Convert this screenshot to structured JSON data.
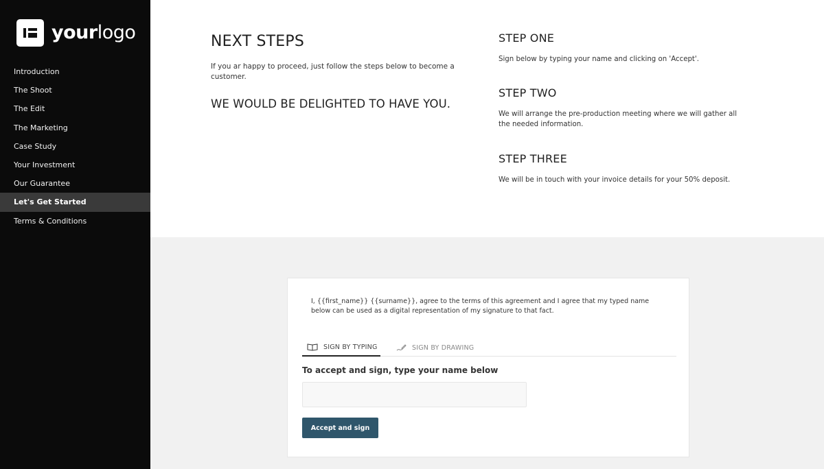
{
  "sidebar": {
    "logo": {
      "bold": "your",
      "light": "logo",
      "icon": "logo-mark-icon"
    },
    "items": [
      {
        "label": "Introduction",
        "active": false
      },
      {
        "label": "The Shoot",
        "active": false
      },
      {
        "label": "The Edit",
        "active": false
      },
      {
        "label": "The Marketing",
        "active": false
      },
      {
        "label": "Case Study",
        "active": false
      },
      {
        "label": "Your Investment",
        "active": false
      },
      {
        "label": "Our Guarantee",
        "active": false
      },
      {
        "label": "Let's Get Started",
        "active": true
      },
      {
        "label": "Terms & Conditions",
        "active": false
      }
    ]
  },
  "main": {
    "title": "NEXT STEPS",
    "intro": "If you ar happy to proceed, just follow the steps below to become a customer.",
    "delighted": "WE WOULD BE DELIGHTED TO HAVE YOU.",
    "steps": [
      {
        "title": "STEP ONE",
        "text": "Sign below by typing your name and clicking on 'Accept'."
      },
      {
        "title": "STEP TWO",
        "text": "We will arrange the pre-production meeting where we will gather all the needed information."
      },
      {
        "title": "STEP THREE",
        "text": "We will be in touch with your invoice details for your 50% deposit."
      }
    ]
  },
  "signature": {
    "agreement": "I, {{first_name}} {{surname}}, agree to the terms of this agreement and I agree that my typed name below can be used as a digital representation of my signature to that fact.",
    "tabs": [
      {
        "label": "SIGN BY TYPING",
        "icon": "keyboard-icon",
        "active": true
      },
      {
        "label": "SIGN BY DRAWING",
        "icon": "pen-icon",
        "active": false
      }
    ],
    "instruction": "To accept and sign, type your name below",
    "name_value": "",
    "name_placeholder": "",
    "button_label": "Accept and sign"
  },
  "colors": {
    "sidebar_bg": "#0b0b0b",
    "active_item_bg": "#3a3a3a",
    "button_bg": "#2f566b",
    "lower_bg": "#f1f1f1"
  }
}
